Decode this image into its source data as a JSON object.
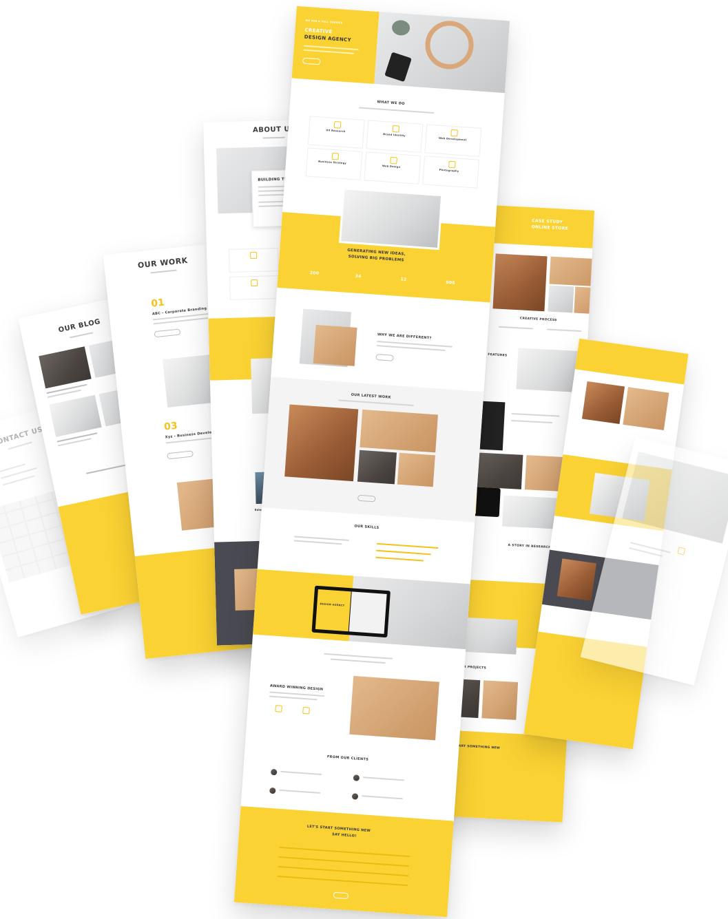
{
  "pages": {
    "contact": {
      "title": "CONTACT US"
    },
    "blog": {
      "title": "OUR BLOG"
    },
    "work": {
      "title": "OUR WORK",
      "num1": "01",
      "num2": "03",
      "item1": "ABC - Corporate Branding",
      "item2": "Xyz - Business Developm..."
    },
    "about": {
      "title": "ABOUT US",
      "card_title": "BUILDING THE FUTURE",
      "person": "Edward Kingsmeller"
    },
    "main": {
      "hero_kicker": "WE ARE A FULL SERVICE",
      "hero_title_1": "CREATIVE",
      "hero_title_2": "DESIGN AGENCY",
      "what_we_do": "WHAT WE DO",
      "services": [
        "UX Research",
        "Brand Identity",
        "Web Development",
        "Business Strategy",
        "Web Design",
        "Photography"
      ],
      "generating_1": "GENERATING NEW IDEAS,",
      "generating_2": "SOLVING BIG PROBLEMS",
      "stats": [
        "200",
        "34",
        "12",
        "906"
      ],
      "why": "WHY WE ARE DIFFERENT?",
      "latest_work": "OUR LATEST WORK",
      "skills": "OUR SKILLS",
      "laptop_title": "DESIGN AGENCY",
      "award": "AWARD WINNING DESIGN",
      "clients": "FROM OUR CLIENTS",
      "cta_1": "LET'S START SOMETHING NEW",
      "cta_2": "SAY HELLO!"
    },
    "case": {
      "title_1": "CASE STUDY",
      "title_2": "ONLINE STORE",
      "creative": "CREATIVE PROCESS",
      "features": "SOFT FEATURES",
      "research": "A STORY IN RESEARCH!",
      "other": "OTHER PROJECTS",
      "start": "LET'S START SOMETHING NEW"
    }
  }
}
